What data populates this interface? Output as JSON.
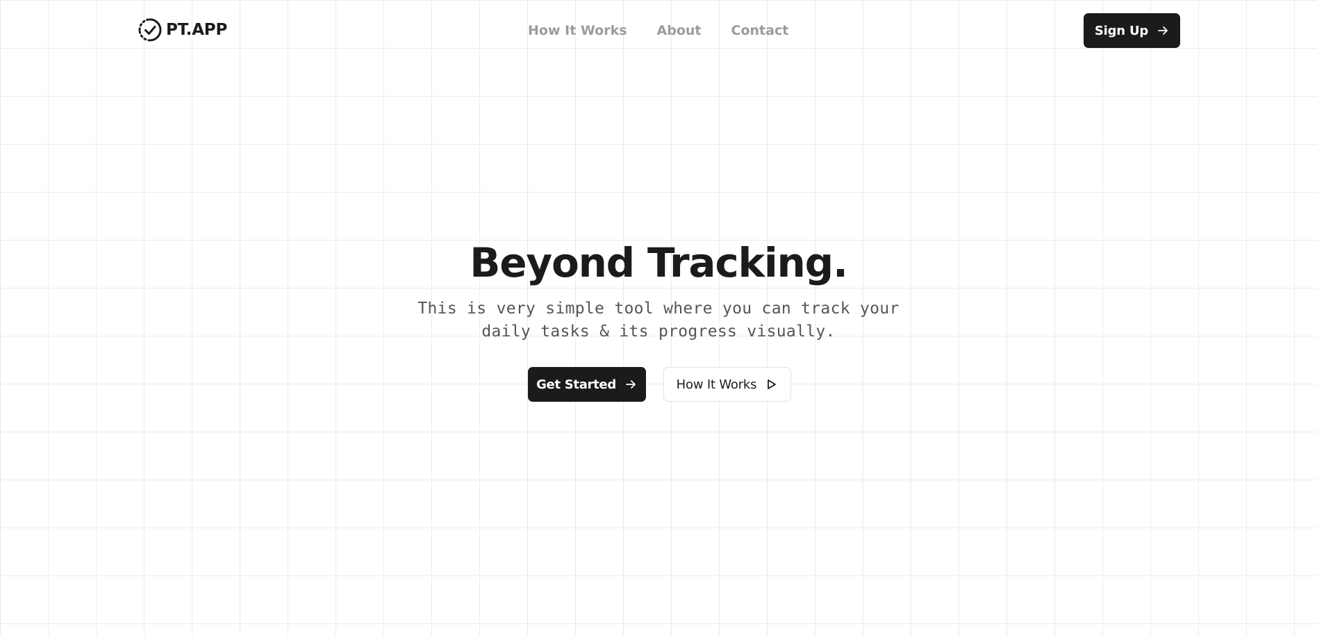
{
  "header": {
    "brand_name": "PT.APP",
    "logo_icon": "progress-check-icon",
    "nav_items": [
      {
        "label": "How It Works"
      },
      {
        "label": "About"
      },
      {
        "label": "Contact"
      }
    ],
    "signup_label": "Sign Up",
    "signup_icon": "arrow-right-icon"
  },
  "hero": {
    "title": "Beyond Tracking.",
    "subtitle": "This is very simple tool where you can track your daily tasks & its progress visually.",
    "primary_cta_label": "Get Started",
    "primary_cta_icon": "arrow-right-icon",
    "secondary_cta_label": "How It Works",
    "secondary_cta_icon": "play-icon"
  },
  "colors": {
    "brand_dark": "#1b1b1b",
    "nav_text": "#9a9aa3",
    "subtitle_text": "#555555",
    "grid_line": "#ebebeb",
    "background": "#ffffff"
  }
}
